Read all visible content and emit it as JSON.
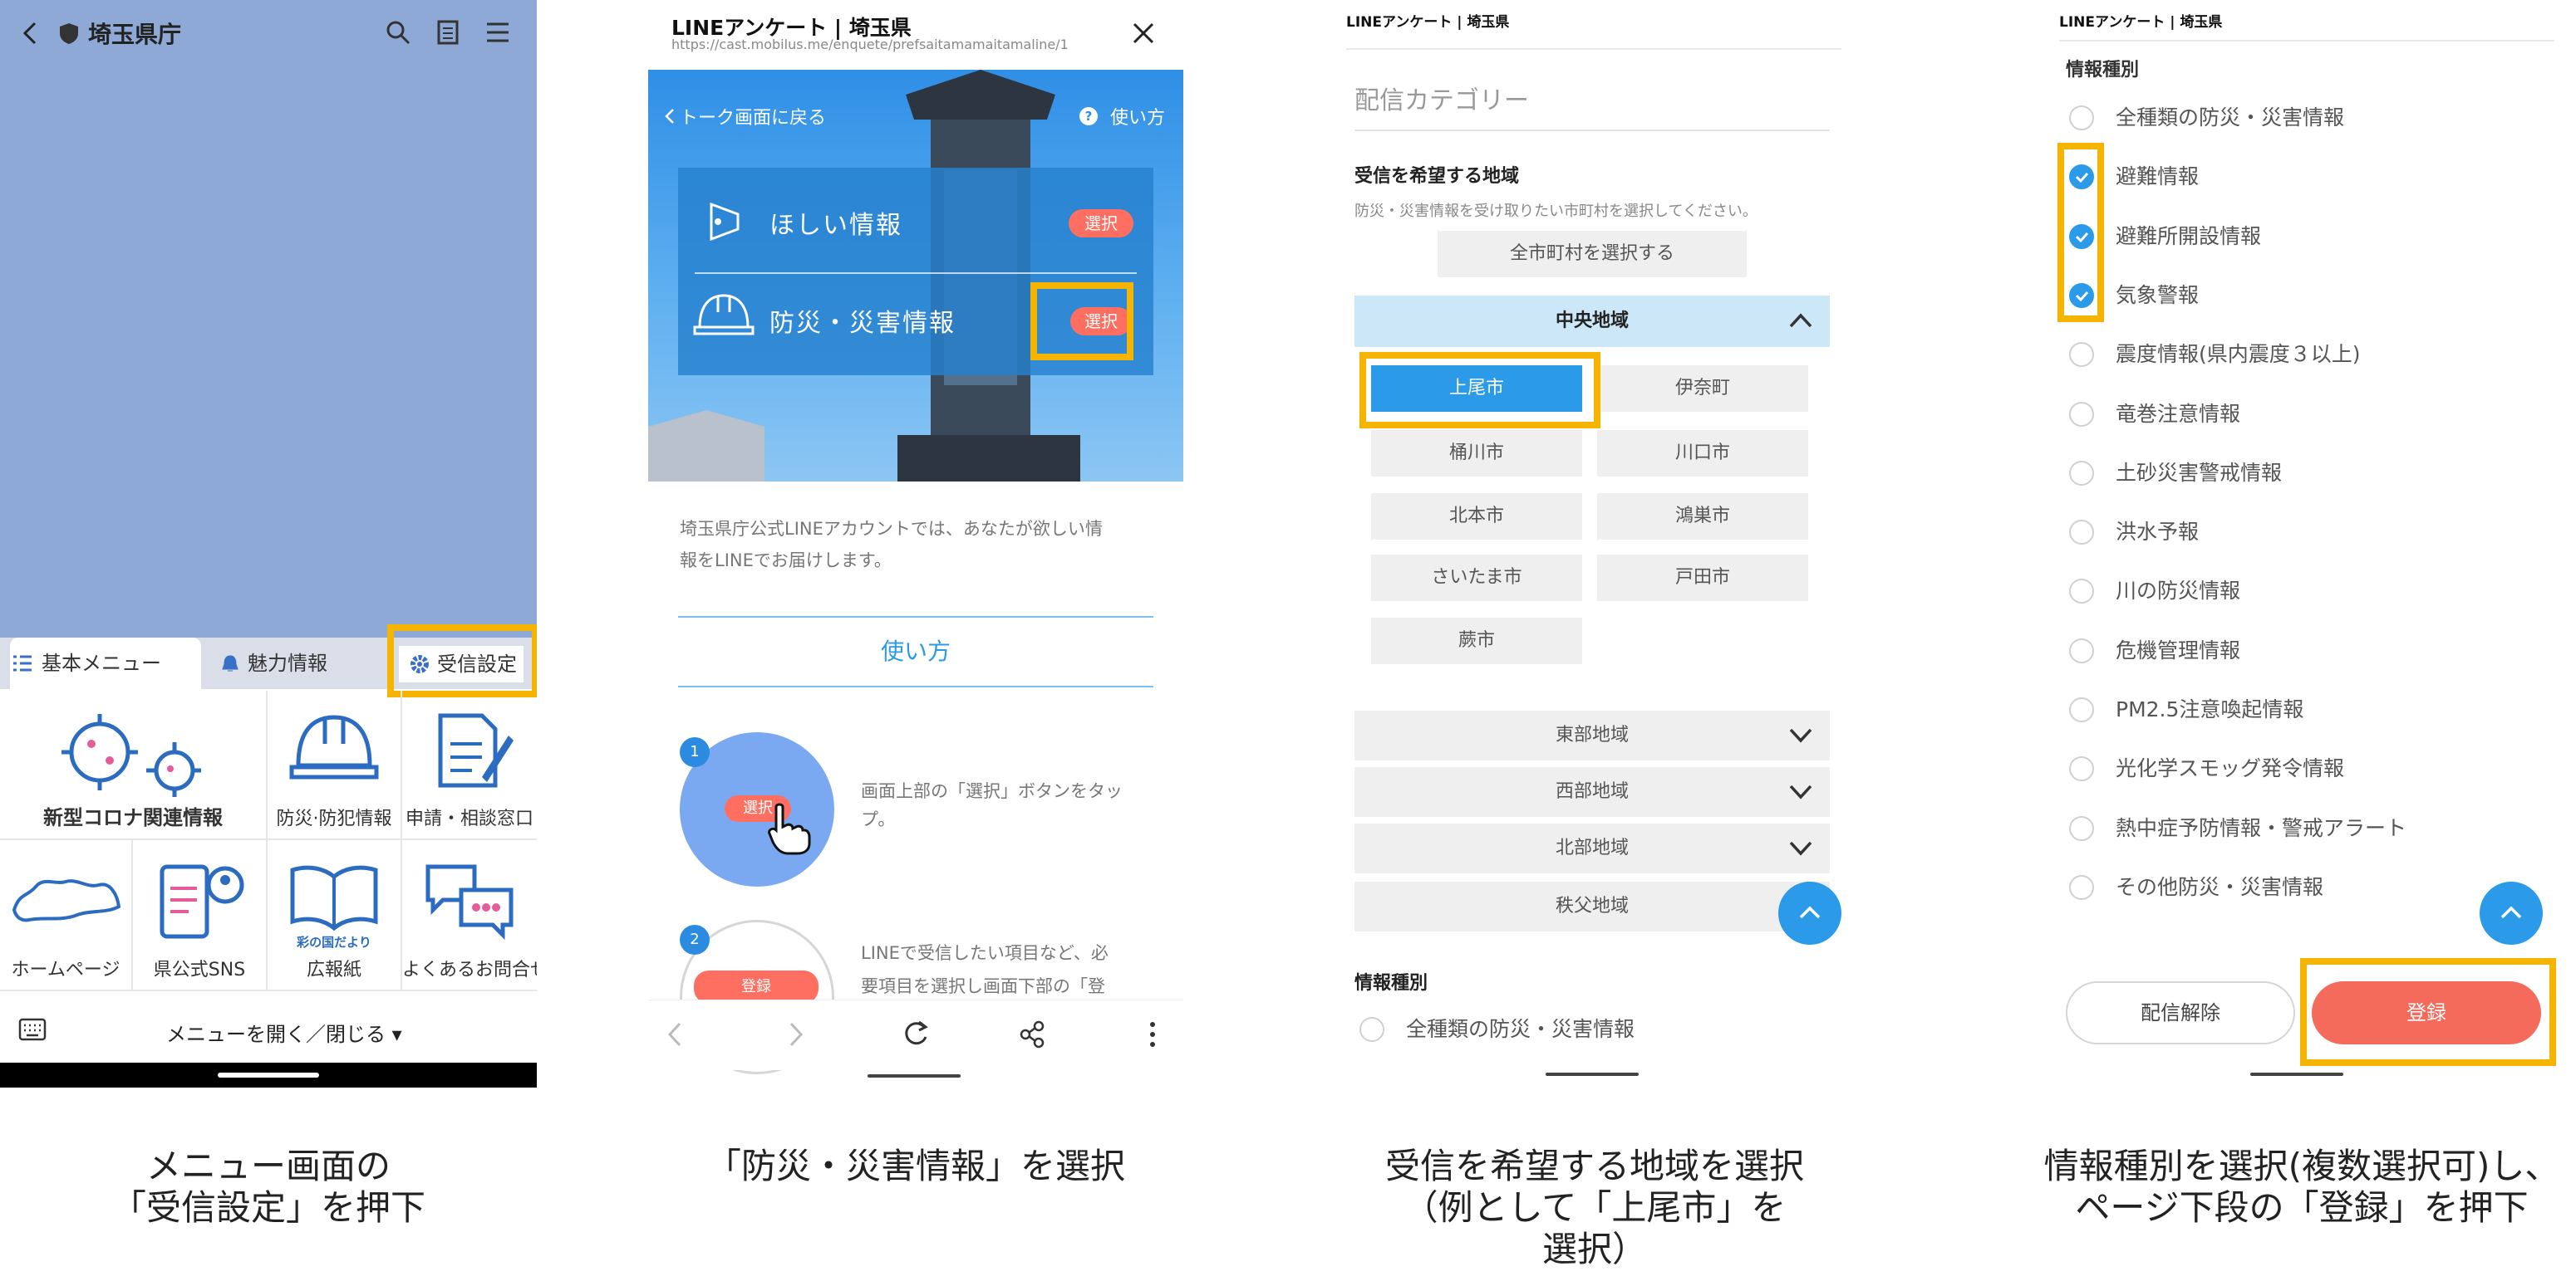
{
  "p1": {
    "title": "埼玉県庁",
    "tabs": [
      "基本メニュー",
      "魅力情報",
      "受信設定"
    ],
    "grid": [
      "新型コロナ関連情報",
      "防災·防犯情報",
      "申請・相談窓口",
      "ホームページ",
      "県公式SNS",
      "広報紙",
      "よくあるお問合せ"
    ],
    "grid_small": "彩の国だより",
    "footer": "メニューを開く／閉じる ▾"
  },
  "p2": {
    "title": "LINEアンケート | 埼玉県",
    "url": "https://cast.mobilus.me/enquete/prefsaitamamaitamaline/1",
    "back": "トーク画面に戻る",
    "help": "使い方",
    "item1": "ほしい情報",
    "item2": "防災・災害情報",
    "select": "選択",
    "desc": [
      "埼玉県庁公式LINEアカウントでは、あなたが欲しい情",
      "報をLINEでお届けします。"
    ],
    "howto": "使い方",
    "step1": {
      "num": "1",
      "text": [
        "画面上部の「選択」ボタンをタッ",
        "プ。"
      ]
    },
    "step2": {
      "num": "2",
      "btn": "登録",
      "text": [
        "LINEで受信したい項目など、必",
        "要項目を選択し画面下部の「登"
      ]
    }
  },
  "p3": {
    "title": "LINEアンケート | 埼玉県",
    "category": "配信カテゴリー",
    "area_heading": "受信を希望する地域",
    "area_note": "防災・災害情報を受け取りたい市町村を選択してください。",
    "all_btn": "全市町村を選択する",
    "central": "中央地域",
    "cities": [
      "上尾市",
      "伊奈町",
      "桶川市",
      "川口市",
      "北本市",
      "鴻巣市",
      "さいたま市",
      "戸田市",
      "蕨市"
    ],
    "regions": [
      "東部地域",
      "西部地域",
      "北部地域",
      "秩父地域"
    ],
    "info_heading": "情報種別",
    "first_option": "全種類の防災・災害情報"
  },
  "p4": {
    "title": "LINEアンケート | 埼玉県",
    "heading": "情報種別",
    "options": [
      "全種類の防災・災害情報",
      "避難情報",
      "避難所開設情報",
      "気象警報",
      "震度情報(県内震度３以上)",
      "竜巻注意情報",
      "土砂災害警戒情報",
      "洪水予報",
      "川の防災情報",
      "危機管理情報",
      "PM2.5注意喚起情報",
      "光化学スモッグ発令情報",
      "熱中症予防情報・警戒アラート",
      "その他防災・災害情報"
    ],
    "checked": [
      false,
      true,
      true,
      true,
      false,
      false,
      false,
      false,
      false,
      false,
      false,
      false,
      false,
      false
    ],
    "cancel": "配信解除",
    "register": "登録"
  },
  "captions": {
    "c1": [
      "メニュー画面の",
      "「受信設定」を押下"
    ],
    "c2": [
      "「防災・災害情報」を選択"
    ],
    "c3": [
      "受信を希望する地域を選択",
      "（例として「上尾市」を",
      "選択）"
    ],
    "c4": [
      "情報種別を選択(複数選択可)し、",
      "ページ下段の「登録」を押下"
    ]
  },
  "colors": {
    "accent": "#2b9ae8",
    "highlight": "#f4b400",
    "select_pill": "#ff6f61",
    "menu_bg": "#8fa9d6"
  }
}
